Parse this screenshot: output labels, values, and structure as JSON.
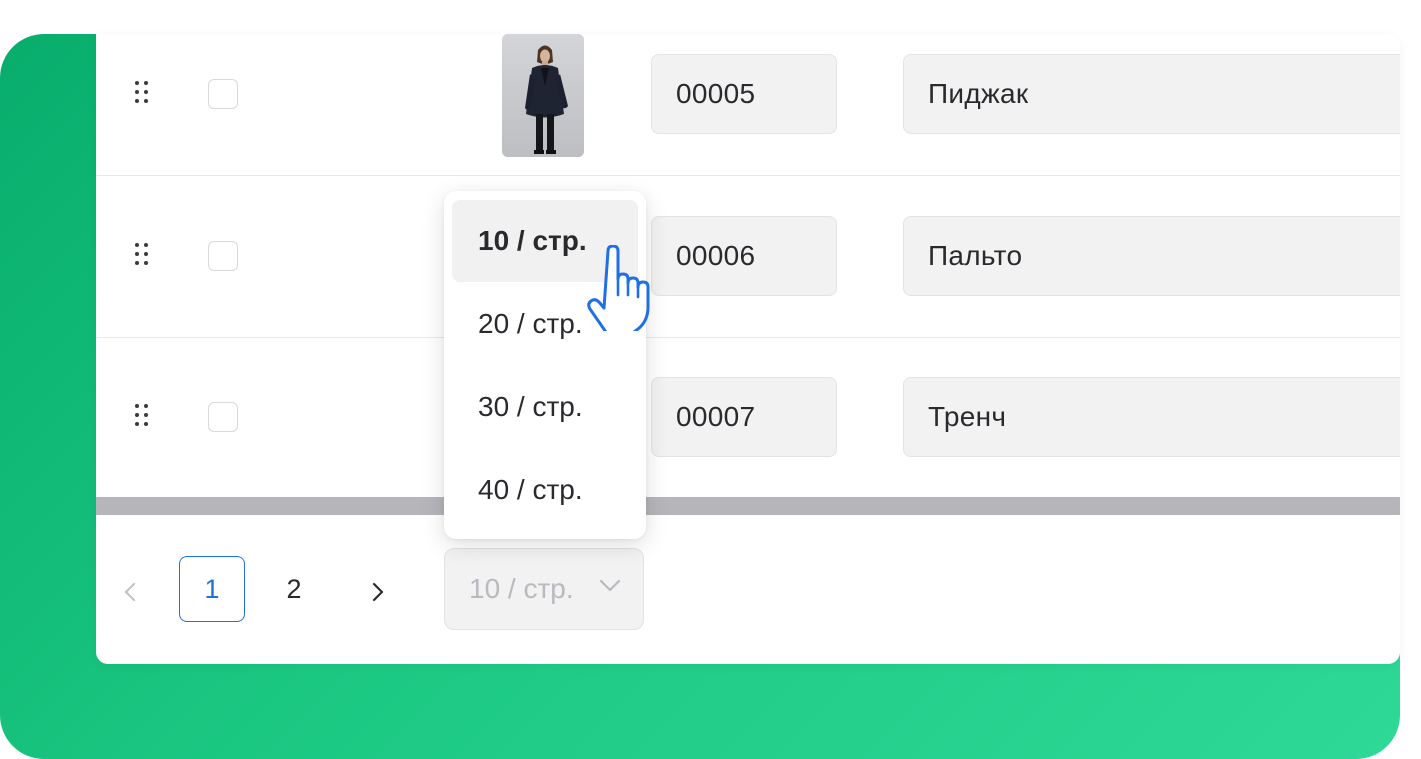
{
  "rows": [
    {
      "code": "00005",
      "name": "Пиджак",
      "has_photo": true
    },
    {
      "code": "00006",
      "name": "Пальто",
      "has_photo": false
    },
    {
      "code": "00007",
      "name": "Тренч",
      "has_photo": false
    }
  ],
  "pagination": {
    "pages": [
      "1",
      "2"
    ],
    "current_page": "1",
    "page_size_value": "10 / стр."
  },
  "page_size_dropdown": {
    "options": [
      "10 / стр.",
      "20 / стр.",
      "30 / стр.",
      "40 / стр."
    ],
    "selected": "10 / стр."
  },
  "icons": {
    "drag": "drag-handle-icon",
    "prev": "chevron-left-icon",
    "next": "chevron-right-icon",
    "select_arrow": "chevron-down-icon",
    "cursor": "hand-pointer-icon"
  },
  "colors": {
    "background_accent": "#1bc882",
    "active_page": "#1f6fe5",
    "cursor": "#1f6fe5"
  }
}
